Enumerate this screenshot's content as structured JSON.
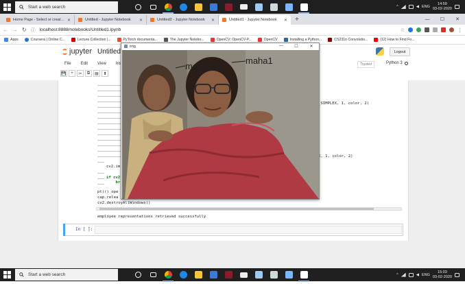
{
  "taskbar_top": {
    "search_placeholder": "Start a web search",
    "time": "14:59",
    "date": "03-02-2020",
    "lang": "ENG"
  },
  "taskbar_bottom": {
    "search_placeholder": "Start a web search",
    "time": "15:03",
    "date": "03-02-2020",
    "lang": "ENG"
  },
  "browser": {
    "tabs": [
      {
        "label": "Home Page - Select or create a n",
        "color": "#f37626"
      },
      {
        "label": "Untitled - Jupyter Notebook",
        "color": "#f37626"
      },
      {
        "label": "Untitled2 - Jupyter Notebook",
        "color": "#f37626"
      },
      {
        "label": "Untitled1 - Jupyter Notebook",
        "color": "#f37626"
      }
    ],
    "url": "localhost:8888/notebooks/Untitled1.ipynb",
    "bookmarks": [
      {
        "label": "Apps",
        "color": "#4285f4"
      },
      {
        "label": "Coursera | Online C...",
        "color": "#2a73cc"
      },
      {
        "label": "Lecture Collection |...",
        "color": "#c00"
      },
      {
        "label": "PyTorch documenta...",
        "color": "#ee4c2c"
      },
      {
        "label": "The Jupyter Notebo...",
        "color": "#555"
      },
      {
        "label": "OpenCV: OpenCV-P...",
        "color": "#e33"
      },
      {
        "label": "OpenCV",
        "color": "#e33"
      },
      {
        "label": "Installing a Python...",
        "color": "#306998"
      },
      {
        "label": "CS231n Convolutio...",
        "color": "#8b0000"
      },
      {
        "label": "(12) How to Find Fo...",
        "color": "#f00"
      }
    ]
  },
  "jupyter": {
    "brand": "jupyter",
    "notebook_title": "Untitled1",
    "logout": "Logout",
    "trusted": "Trusted",
    "kernel": "Python 3",
    "menu": [
      "File",
      "Edit",
      "View",
      "Insert"
    ],
    "toolbar": [
      "💾",
      "+",
      "✂",
      "⧉",
      "▤",
      "⬆"
    ],
    "code": {
      "line_a": "_SIMPLEX, 1, color, 2)",
      "line_b": "X, 1, color, 2)",
      "line_c": "cv2.im",
      "line_d": "if cv2",
      "line_e": "    br",
      "line_f": "pt(() ope",
      "line_g": "cap.relea",
      "line_h": "cv2.destroyAllWindows()"
    },
    "output": "employee representations retrieved successfully",
    "prompt": "In [ ]:"
  },
  "cv_window": {
    "title": "img",
    "label_1": "manasa1",
    "label_2": "maha1"
  }
}
